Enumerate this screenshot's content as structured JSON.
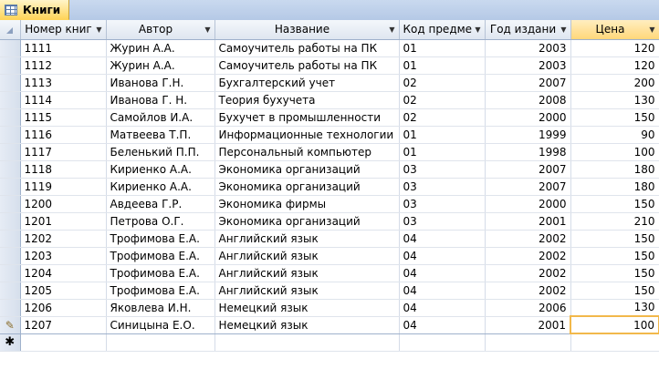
{
  "tab": {
    "title": "Книги",
    "icon": "table-icon"
  },
  "columns": [
    "Номер книг",
    "Автор",
    "Название",
    "Код предме",
    "Год издани",
    "Цена"
  ],
  "rows": [
    [
      "1111",
      "Журин А.А.",
      "Самоучитель работы на ПК",
      "01",
      "2003",
      "120"
    ],
    [
      "1112",
      "Журин А.А.",
      "Самоучитель работы на ПК",
      "01",
      "2003",
      "120"
    ],
    [
      "1113",
      "Иванова Г.Н.",
      "Бухгалтерский учет",
      "02",
      "2007",
      "200"
    ],
    [
      "1114",
      "Иванова Г. Н.",
      "Теория бухучета",
      "02",
      "2008",
      "130"
    ],
    [
      "1115",
      "Самойлов И.А.",
      "Бухучет в промышленности",
      "02",
      "2000",
      "150"
    ],
    [
      "1116",
      "Матвеева Т.П.",
      "Информационные технологии",
      "01",
      "1999",
      "90"
    ],
    [
      "1117",
      "Беленький П.П.",
      "Персональный компьютер",
      "01",
      "1998",
      "100"
    ],
    [
      "1118",
      "Кириенко А.А.",
      "Экономика организаций",
      "03",
      "2007",
      "180"
    ],
    [
      "1119",
      "Кириенко А.А.",
      "Экономика организаций",
      "03",
      "2007",
      "180"
    ],
    [
      "1200",
      "Авдеева Г.Р.",
      "Экономика фирмы",
      "03",
      "2000",
      "150"
    ],
    [
      "1201",
      "Петрова О.Г.",
      "Экономика организаций",
      "03",
      "2001",
      "210"
    ],
    [
      "1202",
      "Трофимова Е.А.",
      "Английский язык",
      "04",
      "2002",
      "150"
    ],
    [
      "1203",
      "Трофимова Е.А.",
      "Английский язык",
      "04",
      "2002",
      "150"
    ],
    [
      "1204",
      "Трофимова Е.А.",
      "Английский язык",
      "04",
      "2002",
      "150"
    ],
    [
      "1205",
      "Трофимова Е.А.",
      "Английский язык",
      "04",
      "2002",
      "150"
    ],
    [
      "1206",
      "Яковлева И.Н.",
      "Немецкий язык",
      "04",
      "2006",
      "130"
    ],
    [
      "1207",
      "Синицына Е.О.",
      "Немецкий язык",
      "04",
      "2001",
      "100"
    ]
  ],
  "current_row_marker": "✎",
  "new_row_marker": "✱",
  "colors": {
    "tab_active": "#ffd45a",
    "header_bg": "#dfe6f0",
    "selected_header": "#ffd77a",
    "focus_border": "#f2b84b"
  }
}
